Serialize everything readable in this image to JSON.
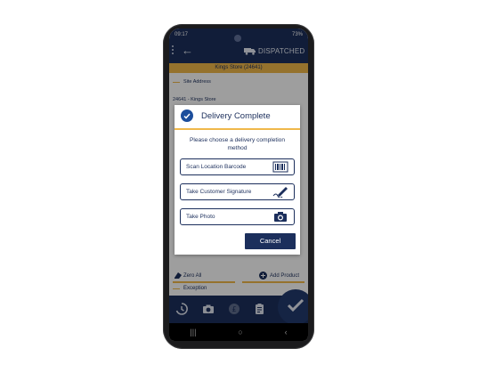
{
  "status_bar": {
    "time": "09:17",
    "battery": "73%"
  },
  "app_bar": {
    "status": "DISPATCHED"
  },
  "store_bar": {
    "title": "Kings Store (24641)"
  },
  "content": {
    "site_address_label": "Site Address",
    "site_address_value": "24641 - Kings Store"
  },
  "bottom_actions": {
    "zero_all": "Zero All",
    "add_product": "Add Product",
    "exception": "Exception"
  },
  "dialog": {
    "title": "Delivery Complete",
    "prompt_line1": "Please choose a delivery completion",
    "prompt_line2": "method",
    "options": [
      {
        "label": "Scan Location Barcode",
        "icon": "barcode-icon"
      },
      {
        "label": "Take Customer Signature",
        "icon": "signature-pen-icon"
      },
      {
        "label": "Take Photo",
        "icon": "camera-icon"
      }
    ],
    "cancel_label": "Cancel"
  },
  "colors": {
    "navy": "#1c2f5c",
    "accent": "#f0b84a",
    "check_blue": "#1c4e9c"
  }
}
